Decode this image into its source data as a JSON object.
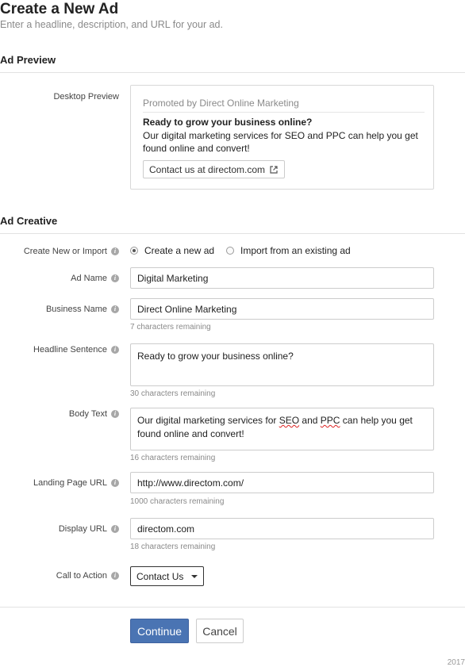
{
  "header": {
    "title": "Create a New Ad",
    "subtitle": "Enter a headline, description, and URL for your ad."
  },
  "ad_preview": {
    "section_title": "Ad Preview",
    "label": "Desktop Preview",
    "promoted": "Promoted by Direct Online Marketing",
    "headline": "Ready to grow your business online?",
    "body": "Our digital marketing services for SEO and PPC can help you get found online and convert!",
    "link_text": "Contact us at directom.com",
    "link_icon": "external-link-icon"
  },
  "ad_creative": {
    "section_title": "Ad Creative",
    "create_or_import": {
      "label": "Create New or Import",
      "options": [
        "Create a new ad",
        "Import from an existing ad"
      ],
      "selected": "Create a new ad"
    },
    "ad_name": {
      "label": "Ad Name",
      "value": "Digital Marketing"
    },
    "business_name": {
      "label": "Business Name",
      "value": "Direct Online Marketing",
      "hint": "7 characters remaining"
    },
    "headline": {
      "label": "Headline Sentence",
      "value": "Ready to grow your business online?",
      "hint": "30 characters remaining"
    },
    "body_text": {
      "label": "Body Text",
      "value_before": "Our digital marketing services for ",
      "seo": "SEO",
      "value_mid": " and ",
      "ppc": "PPC",
      "value_after": " can help you get found online and convert!",
      "hint": "16 characters remaining"
    },
    "landing_url": {
      "label": "Landing Page URL",
      "value": "http://www.directom.com/",
      "hint": "1000 characters remaining"
    },
    "display_url": {
      "label": "Display URL",
      "value": "directom.com",
      "hint": "18 characters remaining"
    },
    "call_to_action": {
      "label": "Call to Action",
      "value": "Contact Us"
    }
  },
  "actions": {
    "continue": "Continue",
    "cancel": "Cancel"
  },
  "footer": {
    "year": "2017"
  },
  "colors": {
    "primary": "#4a74b3",
    "muted": "#8a8a8a",
    "border": "#cccccc"
  }
}
